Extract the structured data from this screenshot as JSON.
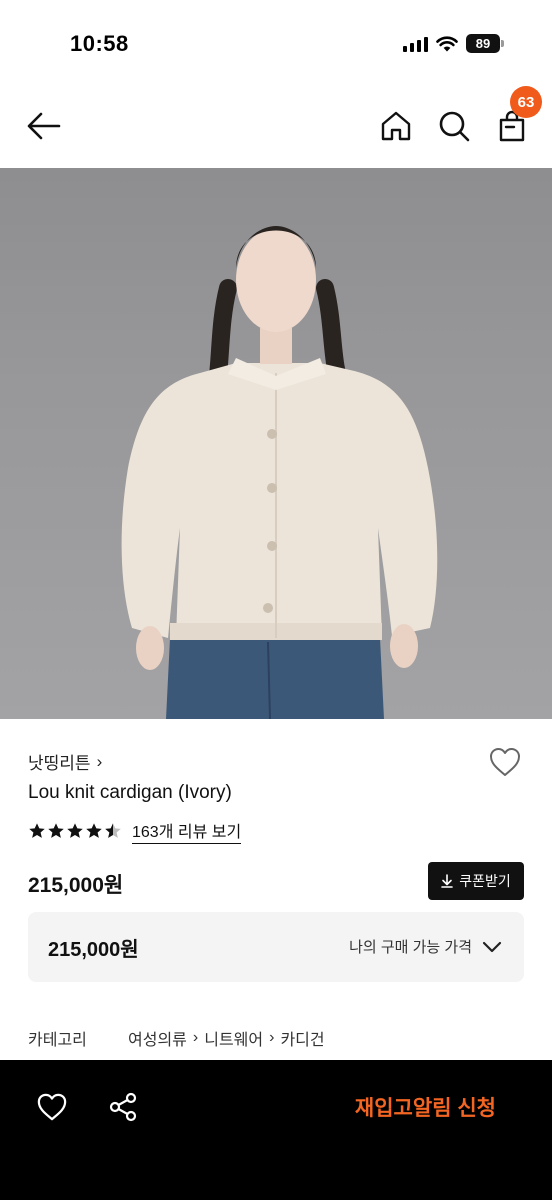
{
  "status_bar": {
    "time": "10:58",
    "battery": "89"
  },
  "nav": {
    "cart_count": "63"
  },
  "product": {
    "brand": "낫띵리튼",
    "brand_chevron": "›",
    "name": "Lou knit cardigan (Ivory)",
    "rating": 4.5,
    "review_link": "163개 리뷰 보기",
    "price": "215,000원",
    "coupon_button": "쿠폰받기",
    "my_price": {
      "value": "215,000원",
      "label": "나의 구매 가능 가격"
    }
  },
  "category": {
    "label": "카테고리",
    "path": [
      "여성의류",
      "니트웨어",
      "카디건"
    ],
    "separator": "›"
  },
  "bottom_bar": {
    "restock_button": "재입고알림 신청"
  },
  "colors": {
    "accent": "#f05a1a",
    "restock_text": "#f26522",
    "bottom_bar_bg": "#000000",
    "price_box_bg": "#f4f4f4"
  },
  "icons": [
    "back-arrow-icon",
    "home-icon",
    "search-icon",
    "shopping-bag-icon",
    "heart-icon",
    "star-icon",
    "download-icon",
    "chevron-down-icon",
    "share-icon"
  ]
}
